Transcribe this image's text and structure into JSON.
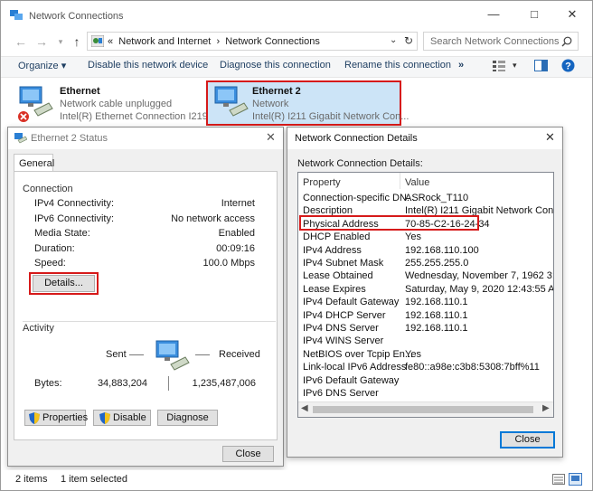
{
  "window": {
    "title": "Network Connections"
  },
  "address": {
    "crumb_prefix": "«",
    "crumb1": "Network and Internet",
    "crumb_sep": "›",
    "crumb2": "Network Connections",
    "search_placeholder": "Search Network Connections"
  },
  "toolbar": {
    "organize": "Organize ▾",
    "disable": "Disable this network device",
    "diagnose": "Diagnose this connection",
    "rename": "Rename this connection",
    "more": "»"
  },
  "connections": [
    {
      "name": "Ethernet",
      "status": "Network cable unplugged",
      "adapter": "Intel(R) Ethernet Connection I219-V"
    },
    {
      "name": "Ethernet 2",
      "status": "Network",
      "adapter": "Intel(R) I211 Gigabit Network Con..."
    }
  ],
  "status_dialog": {
    "title": "Ethernet 2 Status",
    "tab": "General",
    "connection_label": "Connection",
    "rows": [
      {
        "label": "IPv4 Connectivity:",
        "value": "Internet"
      },
      {
        "label": "IPv6 Connectivity:",
        "value": "No network access"
      },
      {
        "label": "Media State:",
        "value": "Enabled"
      },
      {
        "label": "Duration:",
        "value": "00:09:16"
      },
      {
        "label": "Speed:",
        "value": "100.0 Mbps"
      }
    ],
    "details_button": "Details...",
    "activity_label": "Activity",
    "sent_label": "Sent",
    "received_label": "Received",
    "bytes_label": "Bytes:",
    "bytes_sent": "34,883,204",
    "bytes_received": "1,235,487,006",
    "properties_button": "Properties",
    "disable_button": "Disable",
    "diagnose_button": "Diagnose",
    "close_button": "Close"
  },
  "details_dialog": {
    "title": "Network Connection Details",
    "subtitle": "Network Connection Details:",
    "col_property": "Property",
    "col_value": "Value",
    "rows": [
      {
        "property": "Connection-specific DN...",
        "value": "ASRock_T110"
      },
      {
        "property": "Description",
        "value": "Intel(R) I211 Gigabit Network Connection"
      },
      {
        "property": "Physical Address",
        "value": "70-85-C2-16-24-34"
      },
      {
        "property": "DHCP Enabled",
        "value": "Yes"
      },
      {
        "property": "IPv4 Address",
        "value": "192.168.110.100"
      },
      {
        "property": "IPv4 Subnet Mask",
        "value": "255.255.255.0"
      },
      {
        "property": "Lease Obtained",
        "value": "Wednesday, November 7, 1962 3:26:18 /"
      },
      {
        "property": "Lease Expires",
        "value": "Saturday, May 9, 2020 12:43:55 AM"
      },
      {
        "property": "IPv4 Default Gateway",
        "value": "192.168.110.1"
      },
      {
        "property": "IPv4 DHCP Server",
        "value": "192.168.110.1"
      },
      {
        "property": "IPv4 DNS Server",
        "value": "192.168.110.1"
      },
      {
        "property": "IPv4 WINS Server",
        "value": ""
      },
      {
        "property": "NetBIOS over Tcpip En...",
        "value": "Yes"
      },
      {
        "property": "Link-local IPv6 Address",
        "value": "fe80::a98e:c3b8:5308:7bff%11"
      },
      {
        "property": "IPv6 Default Gateway",
        "value": ""
      },
      {
        "property": "IPv6 DNS Server",
        "value": ""
      }
    ],
    "close_button": "Close"
  },
  "statusbar": {
    "items": "2 items",
    "selected": "1 item selected"
  },
  "colors": {
    "highlight_red": "#d61a1a",
    "selection_blue": "#cce4f7",
    "link_blue": "#1f3f62"
  }
}
